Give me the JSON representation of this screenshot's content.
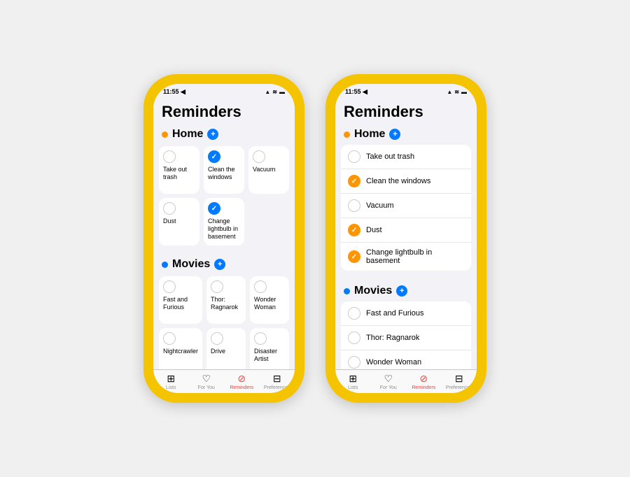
{
  "background": "#f0f0f0",
  "phones": [
    {
      "id": "phone-grid",
      "status_time": "11:55",
      "status_icons": "▲ ≋ 🔋",
      "app_title": "Reminders",
      "sections": [
        {
          "id": "home",
          "title": "Home",
          "dot_color": "orange",
          "view": "grid",
          "items": [
            {
              "label": "Take out trash",
              "checked": false,
              "check_color": ""
            },
            {
              "label": "Clean the windows",
              "checked": true,
              "check_color": "blue"
            },
            {
              "label": "Vacuum",
              "checked": false,
              "check_color": ""
            },
            {
              "label": "Dust",
              "checked": false,
              "check_color": ""
            },
            {
              "label": "Change lightbulb in basement",
              "checked": true,
              "check_color": "blue"
            }
          ]
        },
        {
          "id": "movies",
          "title": "Movies",
          "dot_color": "blue",
          "view": "grid",
          "items": [
            {
              "label": "Fast and Furious",
              "checked": false,
              "check_color": ""
            },
            {
              "label": "Thor: Ragnarok",
              "checked": false,
              "check_color": ""
            },
            {
              "label": "Wonder Woman",
              "checked": false,
              "check_color": ""
            },
            {
              "label": "Nightcrawler",
              "checked": false,
              "check_color": ""
            },
            {
              "label": "Drive",
              "checked": false,
              "check_color": ""
            },
            {
              "label": "Disaster Artist",
              "checked": false,
              "check_color": ""
            }
          ]
        }
      ],
      "tabs": [
        {
          "label": "Lists",
          "icon": "⊞",
          "active": false
        },
        {
          "label": "For You",
          "icon": "♡",
          "active": false
        },
        {
          "label": "Reminders",
          "icon": "⊘",
          "active": true
        },
        {
          "label": "Preferences",
          "icon": "⊟",
          "active": false
        }
      ]
    },
    {
      "id": "phone-list",
      "status_time": "11:55",
      "status_icons": "▲ ≋ 🔋",
      "app_title": "Reminders",
      "sections": [
        {
          "id": "home",
          "title": "Home",
          "dot_color": "orange",
          "view": "list",
          "items": [
            {
              "label": "Take out trash",
              "checked": false
            },
            {
              "label": "Clean the windows",
              "checked": true
            },
            {
              "label": "Vacuum",
              "checked": false
            },
            {
              "label": "Dust",
              "checked": true
            },
            {
              "label": "Change lightbulb in basement",
              "checked": true
            }
          ]
        },
        {
          "id": "movies",
          "title": "Movies",
          "dot_color": "blue",
          "view": "list",
          "items": [
            {
              "label": "Fast and Furious",
              "checked": false
            },
            {
              "label": "Thor: Ragnarok",
              "checked": false
            },
            {
              "label": "Wonder Woman",
              "checked": false
            }
          ]
        }
      ],
      "tabs": [
        {
          "label": "Lists",
          "icon": "⊞",
          "active": false
        },
        {
          "label": "For You",
          "icon": "♡",
          "active": false
        },
        {
          "label": "Reminders",
          "icon": "⊘",
          "active": true
        },
        {
          "label": "Preferences",
          "icon": "⊟",
          "active": false
        }
      ]
    }
  ]
}
